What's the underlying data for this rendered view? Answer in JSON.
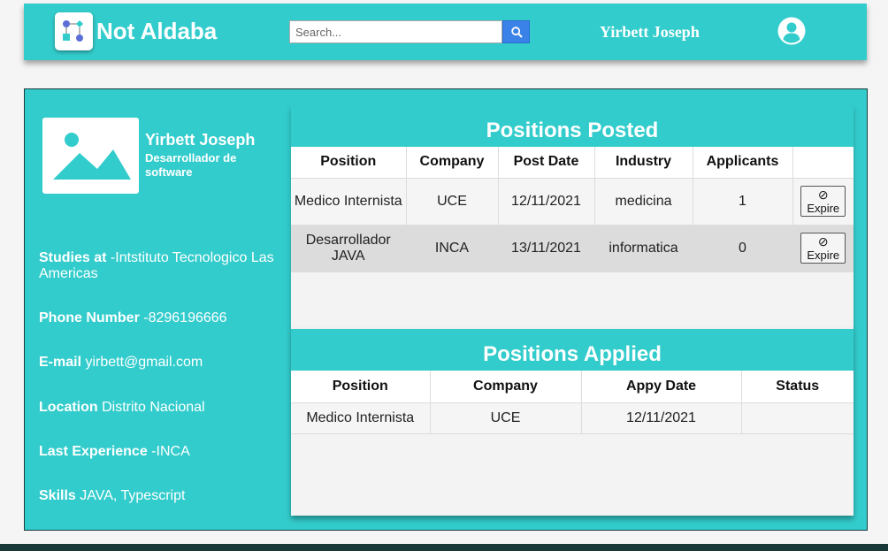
{
  "header": {
    "brand": "Not Aldaba",
    "search_placeholder": "Search...",
    "username": "Yirbett Joseph"
  },
  "profile": {
    "name": "Yirbett Joseph",
    "role": "Desarrollador de software",
    "fields": [
      {
        "label": "Studies at",
        "value": " -Intstituto Tecnologico Las Americas"
      },
      {
        "label": "Phone Number",
        "value": " -8296196666"
      },
      {
        "label": "E-mail",
        "value": " yirbett@gmail.com"
      },
      {
        "label": "Location",
        "value": " Distrito Nacional"
      },
      {
        "label": "Last Experience",
        "value": " -INCA"
      },
      {
        "label": "Skills",
        "value": " JAVA, Typescript"
      }
    ]
  },
  "posted": {
    "title": "Positions Posted",
    "columns": [
      "Position",
      "Company",
      "Post Date",
      "Industry",
      "Applicants",
      ""
    ],
    "rows": [
      {
        "position": "Medico Internista",
        "company": "UCE",
        "date": "12/11/2021",
        "industry": "medicina",
        "applicants": "1",
        "action_symbol": "⊘",
        "action_label": "Expire"
      },
      {
        "position": "Desarrollador JAVA",
        "company": "INCA",
        "date": "13/11/2021",
        "industry": "informatica",
        "applicants": "0",
        "action_symbol": "⊘",
        "action_label": "Expire"
      }
    ]
  },
  "applied": {
    "title": "Positions Applied",
    "columns": [
      "Position",
      "Company",
      "Appy Date",
      "Status"
    ],
    "rows": [
      {
        "position": "Medico Internista",
        "company": "UCE",
        "date": "12/11/2021",
        "status": ""
      }
    ]
  },
  "colors": {
    "accent": "#33cccc",
    "search_button": "#3b82e8",
    "footer": "#1a3a3a"
  },
  "icons": {
    "logo": "flowchart-logo-icon",
    "search": "magnifier-icon",
    "user": "user-circle-icon",
    "profile": "image-placeholder-icon"
  }
}
